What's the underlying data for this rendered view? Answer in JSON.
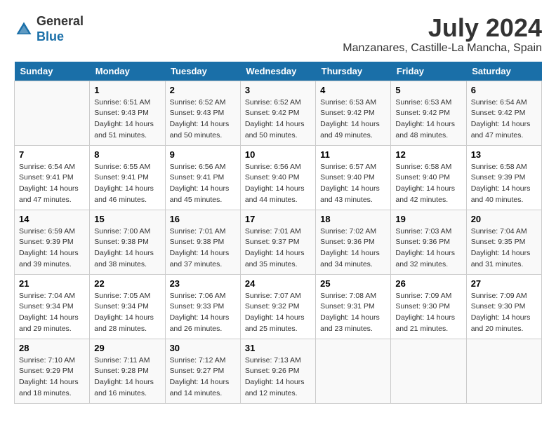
{
  "logo": {
    "general": "General",
    "blue": "Blue"
  },
  "title": {
    "month": "July 2024",
    "location": "Manzanares, Castille-La Mancha, Spain"
  },
  "calendar": {
    "headers": [
      "Sunday",
      "Monday",
      "Tuesday",
      "Wednesday",
      "Thursday",
      "Friday",
      "Saturday"
    ],
    "weeks": [
      [
        {
          "day": "",
          "sunrise": "",
          "sunset": "",
          "daylight": ""
        },
        {
          "day": "1",
          "sunrise": "Sunrise: 6:51 AM",
          "sunset": "Sunset: 9:43 PM",
          "daylight": "Daylight: 14 hours and 51 minutes."
        },
        {
          "day": "2",
          "sunrise": "Sunrise: 6:52 AM",
          "sunset": "Sunset: 9:43 PM",
          "daylight": "Daylight: 14 hours and 50 minutes."
        },
        {
          "day": "3",
          "sunrise": "Sunrise: 6:52 AM",
          "sunset": "Sunset: 9:42 PM",
          "daylight": "Daylight: 14 hours and 50 minutes."
        },
        {
          "day": "4",
          "sunrise": "Sunrise: 6:53 AM",
          "sunset": "Sunset: 9:42 PM",
          "daylight": "Daylight: 14 hours and 49 minutes."
        },
        {
          "day": "5",
          "sunrise": "Sunrise: 6:53 AM",
          "sunset": "Sunset: 9:42 PM",
          "daylight": "Daylight: 14 hours and 48 minutes."
        },
        {
          "day": "6",
          "sunrise": "Sunrise: 6:54 AM",
          "sunset": "Sunset: 9:42 PM",
          "daylight": "Daylight: 14 hours and 47 minutes."
        }
      ],
      [
        {
          "day": "7",
          "sunrise": "Sunrise: 6:54 AM",
          "sunset": "Sunset: 9:41 PM",
          "daylight": "Daylight: 14 hours and 47 minutes."
        },
        {
          "day": "8",
          "sunrise": "Sunrise: 6:55 AM",
          "sunset": "Sunset: 9:41 PM",
          "daylight": "Daylight: 14 hours and 46 minutes."
        },
        {
          "day": "9",
          "sunrise": "Sunrise: 6:56 AM",
          "sunset": "Sunset: 9:41 PM",
          "daylight": "Daylight: 14 hours and 45 minutes."
        },
        {
          "day": "10",
          "sunrise": "Sunrise: 6:56 AM",
          "sunset": "Sunset: 9:40 PM",
          "daylight": "Daylight: 14 hours and 44 minutes."
        },
        {
          "day": "11",
          "sunrise": "Sunrise: 6:57 AM",
          "sunset": "Sunset: 9:40 PM",
          "daylight": "Daylight: 14 hours and 43 minutes."
        },
        {
          "day": "12",
          "sunrise": "Sunrise: 6:58 AM",
          "sunset": "Sunset: 9:40 PM",
          "daylight": "Daylight: 14 hours and 42 minutes."
        },
        {
          "day": "13",
          "sunrise": "Sunrise: 6:58 AM",
          "sunset": "Sunset: 9:39 PM",
          "daylight": "Daylight: 14 hours and 40 minutes."
        }
      ],
      [
        {
          "day": "14",
          "sunrise": "Sunrise: 6:59 AM",
          "sunset": "Sunset: 9:39 PM",
          "daylight": "Daylight: 14 hours and 39 minutes."
        },
        {
          "day": "15",
          "sunrise": "Sunrise: 7:00 AM",
          "sunset": "Sunset: 9:38 PM",
          "daylight": "Daylight: 14 hours and 38 minutes."
        },
        {
          "day": "16",
          "sunrise": "Sunrise: 7:01 AM",
          "sunset": "Sunset: 9:38 PM",
          "daylight": "Daylight: 14 hours and 37 minutes."
        },
        {
          "day": "17",
          "sunrise": "Sunrise: 7:01 AM",
          "sunset": "Sunset: 9:37 PM",
          "daylight": "Daylight: 14 hours and 35 minutes."
        },
        {
          "day": "18",
          "sunrise": "Sunrise: 7:02 AM",
          "sunset": "Sunset: 9:36 PM",
          "daylight": "Daylight: 14 hours and 34 minutes."
        },
        {
          "day": "19",
          "sunrise": "Sunrise: 7:03 AM",
          "sunset": "Sunset: 9:36 PM",
          "daylight": "Daylight: 14 hours and 32 minutes."
        },
        {
          "day": "20",
          "sunrise": "Sunrise: 7:04 AM",
          "sunset": "Sunset: 9:35 PM",
          "daylight": "Daylight: 14 hours and 31 minutes."
        }
      ],
      [
        {
          "day": "21",
          "sunrise": "Sunrise: 7:04 AM",
          "sunset": "Sunset: 9:34 PM",
          "daylight": "Daylight: 14 hours and 29 minutes."
        },
        {
          "day": "22",
          "sunrise": "Sunrise: 7:05 AM",
          "sunset": "Sunset: 9:34 PM",
          "daylight": "Daylight: 14 hours and 28 minutes."
        },
        {
          "day": "23",
          "sunrise": "Sunrise: 7:06 AM",
          "sunset": "Sunset: 9:33 PM",
          "daylight": "Daylight: 14 hours and 26 minutes."
        },
        {
          "day": "24",
          "sunrise": "Sunrise: 7:07 AM",
          "sunset": "Sunset: 9:32 PM",
          "daylight": "Daylight: 14 hours and 25 minutes."
        },
        {
          "day": "25",
          "sunrise": "Sunrise: 7:08 AM",
          "sunset": "Sunset: 9:31 PM",
          "daylight": "Daylight: 14 hours and 23 minutes."
        },
        {
          "day": "26",
          "sunrise": "Sunrise: 7:09 AM",
          "sunset": "Sunset: 9:30 PM",
          "daylight": "Daylight: 14 hours and 21 minutes."
        },
        {
          "day": "27",
          "sunrise": "Sunrise: 7:09 AM",
          "sunset": "Sunset: 9:30 PM",
          "daylight": "Daylight: 14 hours and 20 minutes."
        }
      ],
      [
        {
          "day": "28",
          "sunrise": "Sunrise: 7:10 AM",
          "sunset": "Sunset: 9:29 PM",
          "daylight": "Daylight: 14 hours and 18 minutes."
        },
        {
          "day": "29",
          "sunrise": "Sunrise: 7:11 AM",
          "sunset": "Sunset: 9:28 PM",
          "daylight": "Daylight: 14 hours and 16 minutes."
        },
        {
          "day": "30",
          "sunrise": "Sunrise: 7:12 AM",
          "sunset": "Sunset: 9:27 PM",
          "daylight": "Daylight: 14 hours and 14 minutes."
        },
        {
          "day": "31",
          "sunrise": "Sunrise: 7:13 AM",
          "sunset": "Sunset: 9:26 PM",
          "daylight": "Daylight: 14 hours and 12 minutes."
        },
        {
          "day": "",
          "sunrise": "",
          "sunset": "",
          "daylight": ""
        },
        {
          "day": "",
          "sunrise": "",
          "sunset": "",
          "daylight": ""
        },
        {
          "day": "",
          "sunrise": "",
          "sunset": "",
          "daylight": ""
        }
      ]
    ]
  }
}
